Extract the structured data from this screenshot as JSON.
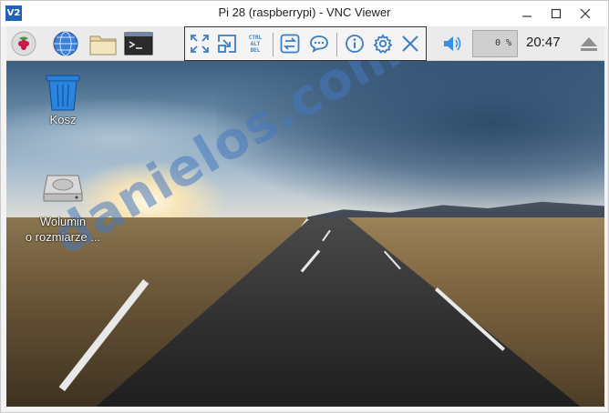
{
  "window": {
    "title": "Pi 28 (raspberrypi) - VNC Viewer",
    "app_icon_text": "V2"
  },
  "panel": {
    "clock": "20:47",
    "cpu_usage": "0 %"
  },
  "vnc_toolbar": {
    "ctrl_alt_del": [
      "CTRL",
      "ALT",
      "DEL"
    ]
  },
  "desktop": {
    "icons": [
      {
        "label": "Kosz"
      },
      {
        "label_line1": "Wolumin",
        "label_line2": "o rozmiarze ..."
      }
    ],
    "watermark": "danielos.com.pl"
  },
  "colors": {
    "accent": "#3a7fc1",
    "raspberry": "#c51a4a"
  }
}
